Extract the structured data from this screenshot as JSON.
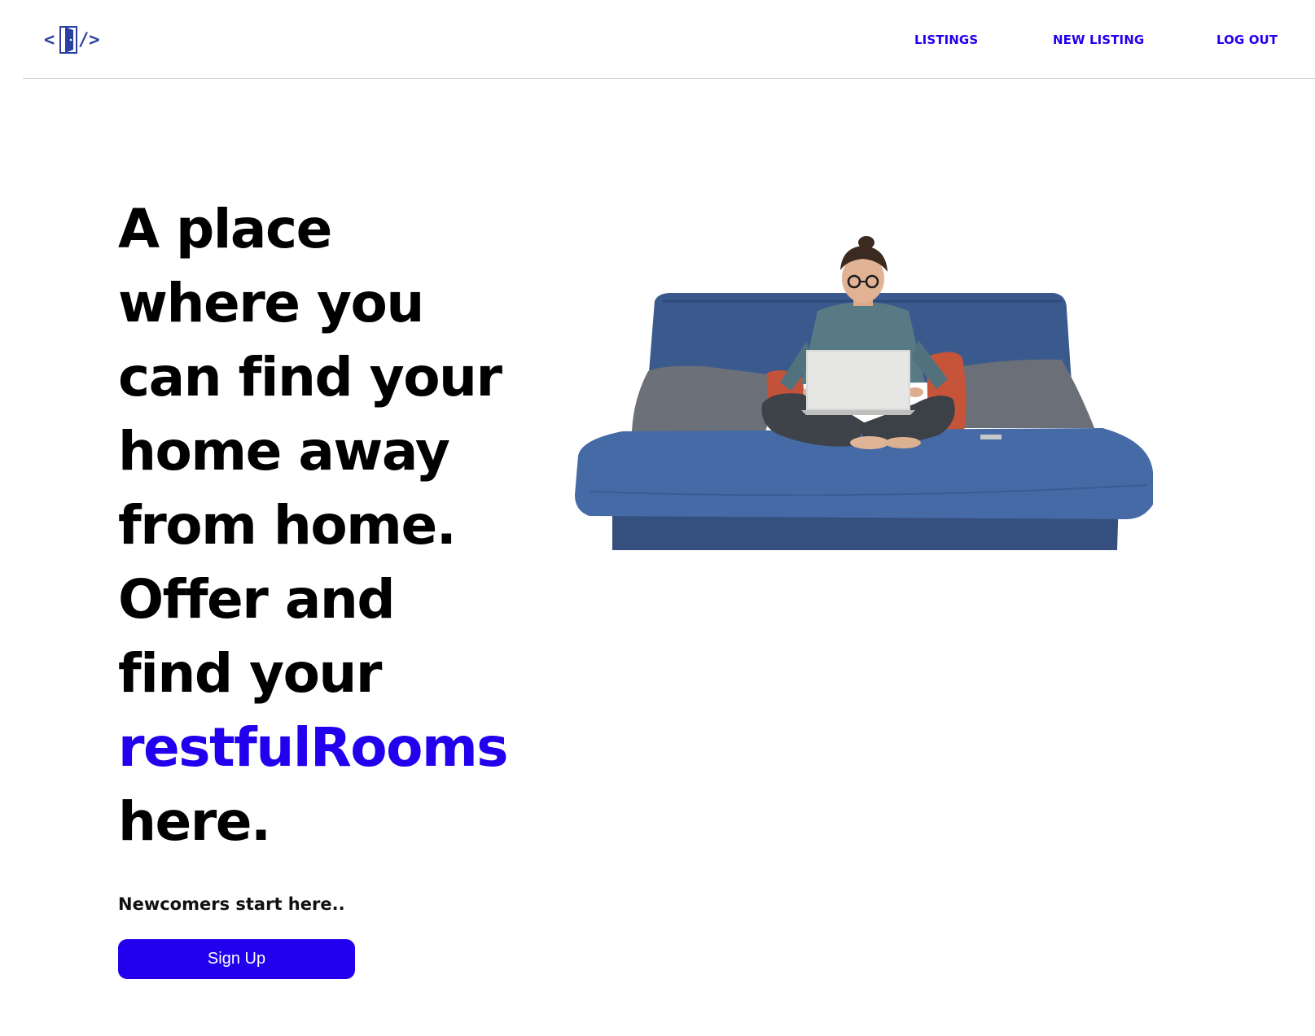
{
  "colors": {
    "brand": "#2200ee",
    "text": "#000000",
    "divider": "#cfcfcf"
  },
  "header": {
    "logo_icon": "door-code-icon",
    "nav": {
      "listings": "LISTINGS",
      "new_listing": "NEW LISTING",
      "log_out": "LOG OUT"
    }
  },
  "hero": {
    "heading_lines": [
      "A place",
      "where you",
      "can find your",
      "home away",
      "from home.",
      "Offer and",
      "find your"
    ],
    "brand_name": "restfulRooms",
    "heading_end": "here.",
    "newcomers_text": "Newcomers start here..",
    "signup_label": "Sign Up",
    "image_icon": "woman-on-sofa-with-laptop-illustration"
  }
}
